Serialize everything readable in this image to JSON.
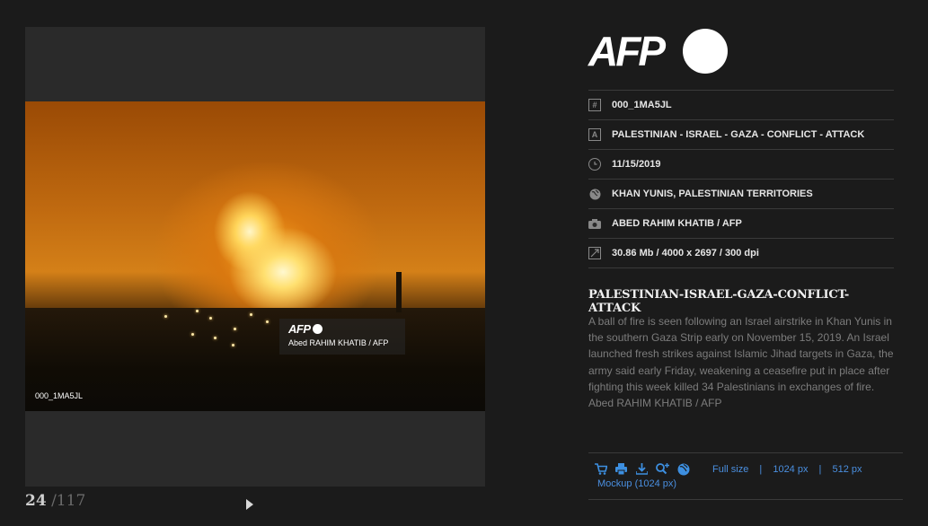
{
  "viewer": {
    "photo_id_overlay": "000_1MA5JL",
    "watermark_logo": "AFP",
    "watermark_credit": "Abed RAHIM KHATIB / AFP"
  },
  "counter": {
    "current": "24",
    "total": "/117"
  },
  "brand": {
    "logo_text": "AFP"
  },
  "meta": {
    "id": "000_1MA5JL",
    "keywords": "PALESTINIAN - ISRAEL - GAZA - CONFLICT - ATTACK",
    "date": "11/15/2019",
    "location": "KHAN YUNIS, PALESTINIAN TERRITORIES",
    "photographer": "ABED RAHIM KHATIB / AFP",
    "file_info": "30.86 Mb / 4000 x 2697 / 300 dpi"
  },
  "headline": "PALESTINIAN-ISRAEL-GAZA-CONFLICT-ATTACK",
  "caption": "A ball of fire is seen following an Israel airstrike in Khan Yunis in the southern Gaza Strip early on November 15, 2019. An Israel launched fresh strikes against Islamic Jihad targets in Gaza, the army said early Friday, weakening a ceasefire put in place after fighting this week killed 34 Palestinians in exchanges of fire. Abed RAHIM KHATIB / AFP",
  "download": {
    "full_size": "Full size",
    "px1024": "1024 px",
    "px512": "512 px",
    "mockup": "Mockup (1024 px)",
    "sep": "|"
  },
  "icons": {
    "cart": "cart-icon",
    "print": "print-icon",
    "download": "download-icon",
    "zoom": "zoom-icon",
    "globe": "globe-icon"
  },
  "colors": {
    "link": "#4a8fe0",
    "background": "#1b1b1b"
  }
}
